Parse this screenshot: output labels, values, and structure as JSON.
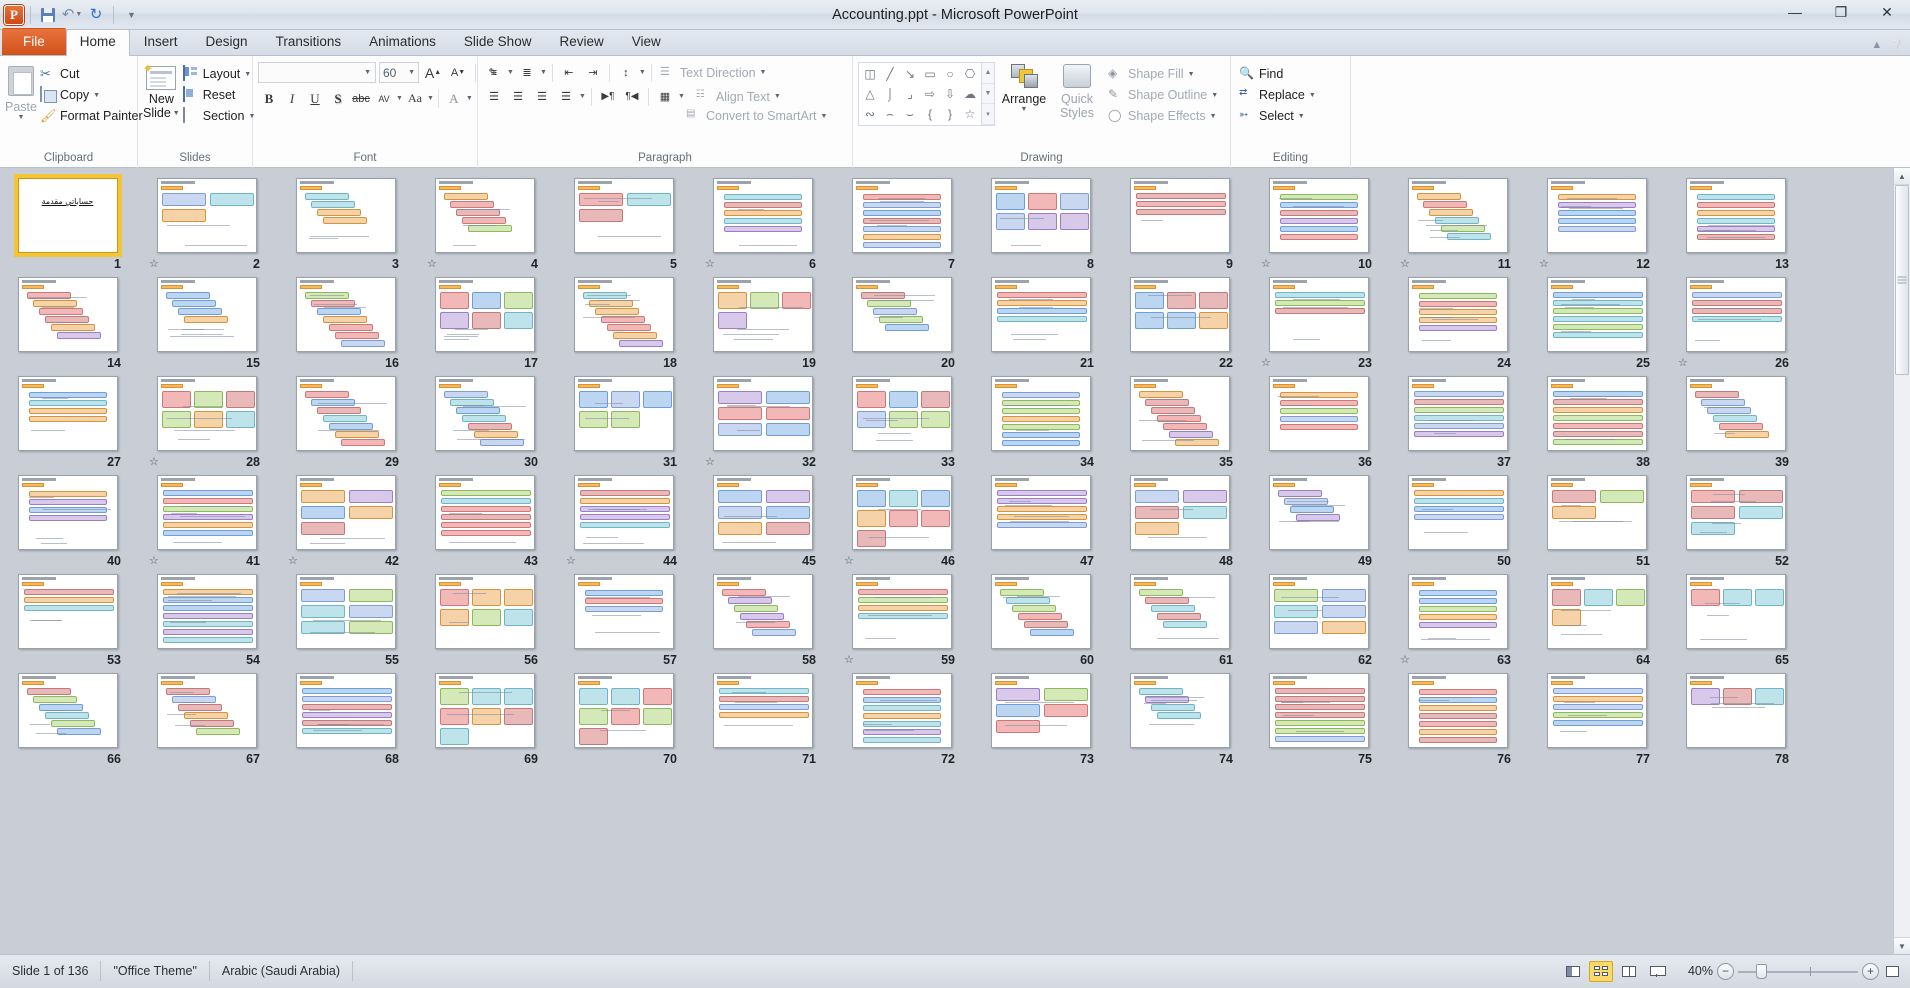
{
  "titlebar": {
    "app_icon": "powerpoint-logo",
    "title": "Accounting.ppt  -  Microsoft PowerPoint",
    "quick_access": [
      {
        "name": "save-button",
        "icon": "save-icon",
        "label": "Save"
      },
      {
        "name": "undo-button",
        "icon": "undo-icon",
        "label": "Undo"
      },
      {
        "name": "redo-button",
        "icon": "redo-icon",
        "label": "Repeat"
      },
      {
        "name": "customize-qat-button",
        "icon": "chevron-down-icon",
        "label": "Customize Quick Access Toolbar"
      }
    ],
    "window_controls": [
      {
        "name": "minimize-button",
        "glyph": "—"
      },
      {
        "name": "restore-button",
        "glyph": "❐"
      },
      {
        "name": "close-button",
        "glyph": "✕"
      }
    ]
  },
  "tabs": [
    {
      "label": "File",
      "kind": "file"
    },
    {
      "label": "Home",
      "kind": "active"
    },
    {
      "label": "Insert",
      "kind": "normal"
    },
    {
      "label": "Design",
      "kind": "normal"
    },
    {
      "label": "Transitions",
      "kind": "normal"
    },
    {
      "label": "Animations",
      "kind": "normal"
    },
    {
      "label": "Slide Show",
      "kind": "normal"
    },
    {
      "label": "Review",
      "kind": "normal"
    },
    {
      "label": "View",
      "kind": "normal"
    }
  ],
  "ribbon": {
    "clipboard": {
      "group_label": "Clipboard",
      "paste_label": "Paste",
      "items": [
        {
          "label": "Cut",
          "icon": "scissors-icon"
        },
        {
          "label": "Copy",
          "icon": "copy-icon",
          "has_arrow": true
        },
        {
          "label": "Format Painter",
          "icon": "paintbrush-icon"
        }
      ]
    },
    "slides": {
      "group_label": "Slides",
      "new_slide_label": "New\nSlide",
      "new_slide_line1": "New",
      "new_slide_line2": "Slide",
      "items": [
        {
          "label": "Layout",
          "icon": "layout-icon",
          "has_arrow": true
        },
        {
          "label": "Reset",
          "icon": "reset-icon",
          "has_arrow": false
        },
        {
          "label": "Section",
          "icon": "section-icon",
          "has_arrow": true
        }
      ]
    },
    "font": {
      "group_label": "Font",
      "font_name_value": "",
      "font_name_placeholder": "",
      "font_size_value": "60",
      "buttons_row1": [
        "grow-font-icon",
        "shrink-font-icon",
        "clear-formatting-icon"
      ],
      "buttons_row2": [
        "bold-icon",
        "italic-icon",
        "underline-icon",
        "shadow-icon",
        "strikethrough-icon",
        "character-spacing-icon",
        "change-case-icon",
        "font-color-icon"
      ],
      "bold": "B",
      "italic": "I",
      "underline": "U",
      "shadow": "S",
      "strikethrough": "abc",
      "spacing": "AV",
      "change_case": "Aa",
      "font_color": "A",
      "grow": "A",
      "shrink": "A"
    },
    "paragraph": {
      "group_label": "Paragraph",
      "text_direction": "Text Direction",
      "align_text": "Align Text",
      "convert_to_smartart": "Convert to SmartArt"
    },
    "drawing": {
      "group_label": "Drawing",
      "shapes": [
        "textbox-shape",
        "line-shape",
        "arrow-shape",
        "rectangle-shape",
        "oval-shape",
        "rounded-rect-shape",
        "triangle-shape",
        "elbow-connector-shape",
        "elbow-arrow-shape",
        "right-arrow-shape",
        "down-arrow-shape",
        "cloud-shape",
        "scribble-shape",
        "arc-shape",
        "curve-shape",
        "left-brace-shape",
        "right-brace-shape",
        "star-shape"
      ],
      "arrange_label": "Arrange",
      "quick_styles_line1": "Quick",
      "quick_styles_line2": "Styles",
      "shape_fill": "Shape Fill",
      "shape_outline": "Shape Outline",
      "shape_effects": "Shape Effects"
    },
    "editing": {
      "group_label": "Editing",
      "find": "Find",
      "replace": "Replace",
      "select": "Select"
    }
  },
  "sorter": {
    "selected_slide": 1,
    "slides": [
      {
        "n": 1,
        "anim": false,
        "title": "حساباتي مقدمة"
      },
      {
        "n": 2,
        "anim": true
      },
      {
        "n": 3,
        "anim": false
      },
      {
        "n": 4,
        "anim": true
      },
      {
        "n": 5,
        "anim": false
      },
      {
        "n": 6,
        "anim": true
      },
      {
        "n": 7,
        "anim": false
      },
      {
        "n": 8,
        "anim": false
      },
      {
        "n": 9,
        "anim": false
      },
      {
        "n": 10,
        "anim": true
      },
      {
        "n": 11,
        "anim": true
      },
      {
        "n": 12,
        "anim": true
      },
      {
        "n": 13,
        "anim": false
      },
      {
        "n": 14,
        "anim": false
      },
      {
        "n": 15,
        "anim": false
      },
      {
        "n": 16,
        "anim": false
      },
      {
        "n": 17,
        "anim": false
      },
      {
        "n": 18,
        "anim": false
      },
      {
        "n": 19,
        "anim": false
      },
      {
        "n": 20,
        "anim": false
      },
      {
        "n": 21,
        "anim": false
      },
      {
        "n": 22,
        "anim": false
      },
      {
        "n": 23,
        "anim": true
      },
      {
        "n": 24,
        "anim": false
      },
      {
        "n": 25,
        "anim": false
      },
      {
        "n": 26,
        "anim": true
      },
      {
        "n": 27,
        "anim": false
      },
      {
        "n": 28,
        "anim": true
      },
      {
        "n": 29,
        "anim": false
      },
      {
        "n": 30,
        "anim": false
      },
      {
        "n": 31,
        "anim": false
      },
      {
        "n": 32,
        "anim": true
      },
      {
        "n": 33,
        "anim": false
      },
      {
        "n": 34,
        "anim": false
      },
      {
        "n": 35,
        "anim": false
      },
      {
        "n": 36,
        "anim": false
      },
      {
        "n": 37,
        "anim": false
      },
      {
        "n": 38,
        "anim": false
      },
      {
        "n": 39,
        "anim": false
      },
      {
        "n": 40,
        "anim": false
      },
      {
        "n": 41,
        "anim": true
      },
      {
        "n": 42,
        "anim": true
      },
      {
        "n": 43,
        "anim": false
      },
      {
        "n": 44,
        "anim": true
      },
      {
        "n": 45,
        "anim": false
      },
      {
        "n": 46,
        "anim": true
      },
      {
        "n": 47,
        "anim": false
      },
      {
        "n": 48,
        "anim": false
      },
      {
        "n": 49,
        "anim": false
      },
      {
        "n": 50,
        "anim": false
      },
      {
        "n": 51,
        "anim": false
      },
      {
        "n": 52,
        "anim": false
      },
      {
        "n": 53,
        "anim": false
      },
      {
        "n": 54,
        "anim": false
      },
      {
        "n": 55,
        "anim": false
      },
      {
        "n": 56,
        "anim": false
      },
      {
        "n": 57,
        "anim": false
      },
      {
        "n": 58,
        "anim": false
      },
      {
        "n": 59,
        "anim": true
      },
      {
        "n": 60,
        "anim": false
      },
      {
        "n": 61,
        "anim": false
      },
      {
        "n": 62,
        "anim": false
      },
      {
        "n": 63,
        "anim": true
      },
      {
        "n": 64,
        "anim": false
      },
      {
        "n": 65,
        "anim": false
      },
      {
        "n": 66,
        "anim": false
      },
      {
        "n": 67,
        "anim": false
      },
      {
        "n": 68,
        "anim": false
      },
      {
        "n": 69,
        "anim": false
      },
      {
        "n": 70,
        "anim": false
      },
      {
        "n": 71,
        "anim": false
      },
      {
        "n": 72,
        "anim": false
      },
      {
        "n": 73,
        "anim": false
      },
      {
        "n": 74,
        "anim": false
      },
      {
        "n": 75,
        "anim": false
      },
      {
        "n": 76,
        "anim": false
      },
      {
        "n": 77,
        "anim": false
      },
      {
        "n": 78,
        "anim": false
      }
    ]
  },
  "statusbar": {
    "slide_counter": "Slide 1 of 136",
    "theme": "\"Office Theme\"",
    "language": "Arabic (Saudi Arabia)",
    "zoom_level": "40%",
    "views": [
      {
        "name": "normal-view-button",
        "label": "Normal",
        "active": false
      },
      {
        "name": "slide-sorter-view-button",
        "label": "Slide Sorter",
        "active": true
      },
      {
        "name": "reading-view-button",
        "label": "Reading View",
        "active": false
      },
      {
        "name": "slide-show-button",
        "label": "Slide Show",
        "active": false
      }
    ],
    "zoom_out": "−",
    "zoom_in": "+",
    "fit_label": "Fit slide to current window"
  },
  "colors": {
    "accent_orange": "#d2511a",
    "selection_yellow": "#f5c437",
    "ribbon_bg": "#fdfdfe",
    "sorter_bg": "#c9ced6"
  }
}
